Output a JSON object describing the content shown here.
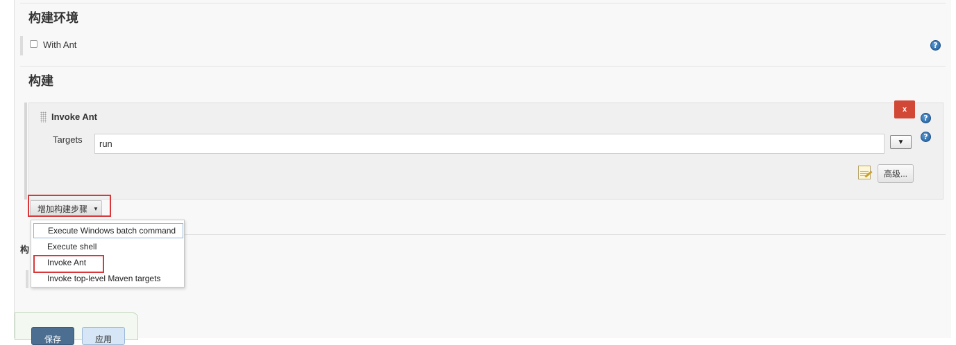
{
  "build_env": {
    "title": "构建环境",
    "with_ant_label": "With Ant",
    "with_ant_checked": false
  },
  "build": {
    "title": "构建",
    "step": {
      "title": "Invoke Ant",
      "delete_label": "x",
      "targets_label": "Targets",
      "targets_value": "run",
      "expand_label": "▼",
      "advanced_label": "高级..."
    },
    "add_step_label": "增加构建步骤",
    "menu_items": [
      "Execute Windows batch command",
      "Execute shell",
      "Invoke Ant",
      "Invoke top-level Maven targets"
    ]
  },
  "footer": {
    "save_label": "保存",
    "apply_label": "应用"
  },
  "icons": {
    "help": "help-icon",
    "notepad": "notepad-icon",
    "drag": "drag-handle-icon"
  },
  "colors": {
    "delete_button": "#d24836",
    "highlight": "#d9373a",
    "save_button": "#4b6e91",
    "apply_button": "#d7e6f6"
  }
}
